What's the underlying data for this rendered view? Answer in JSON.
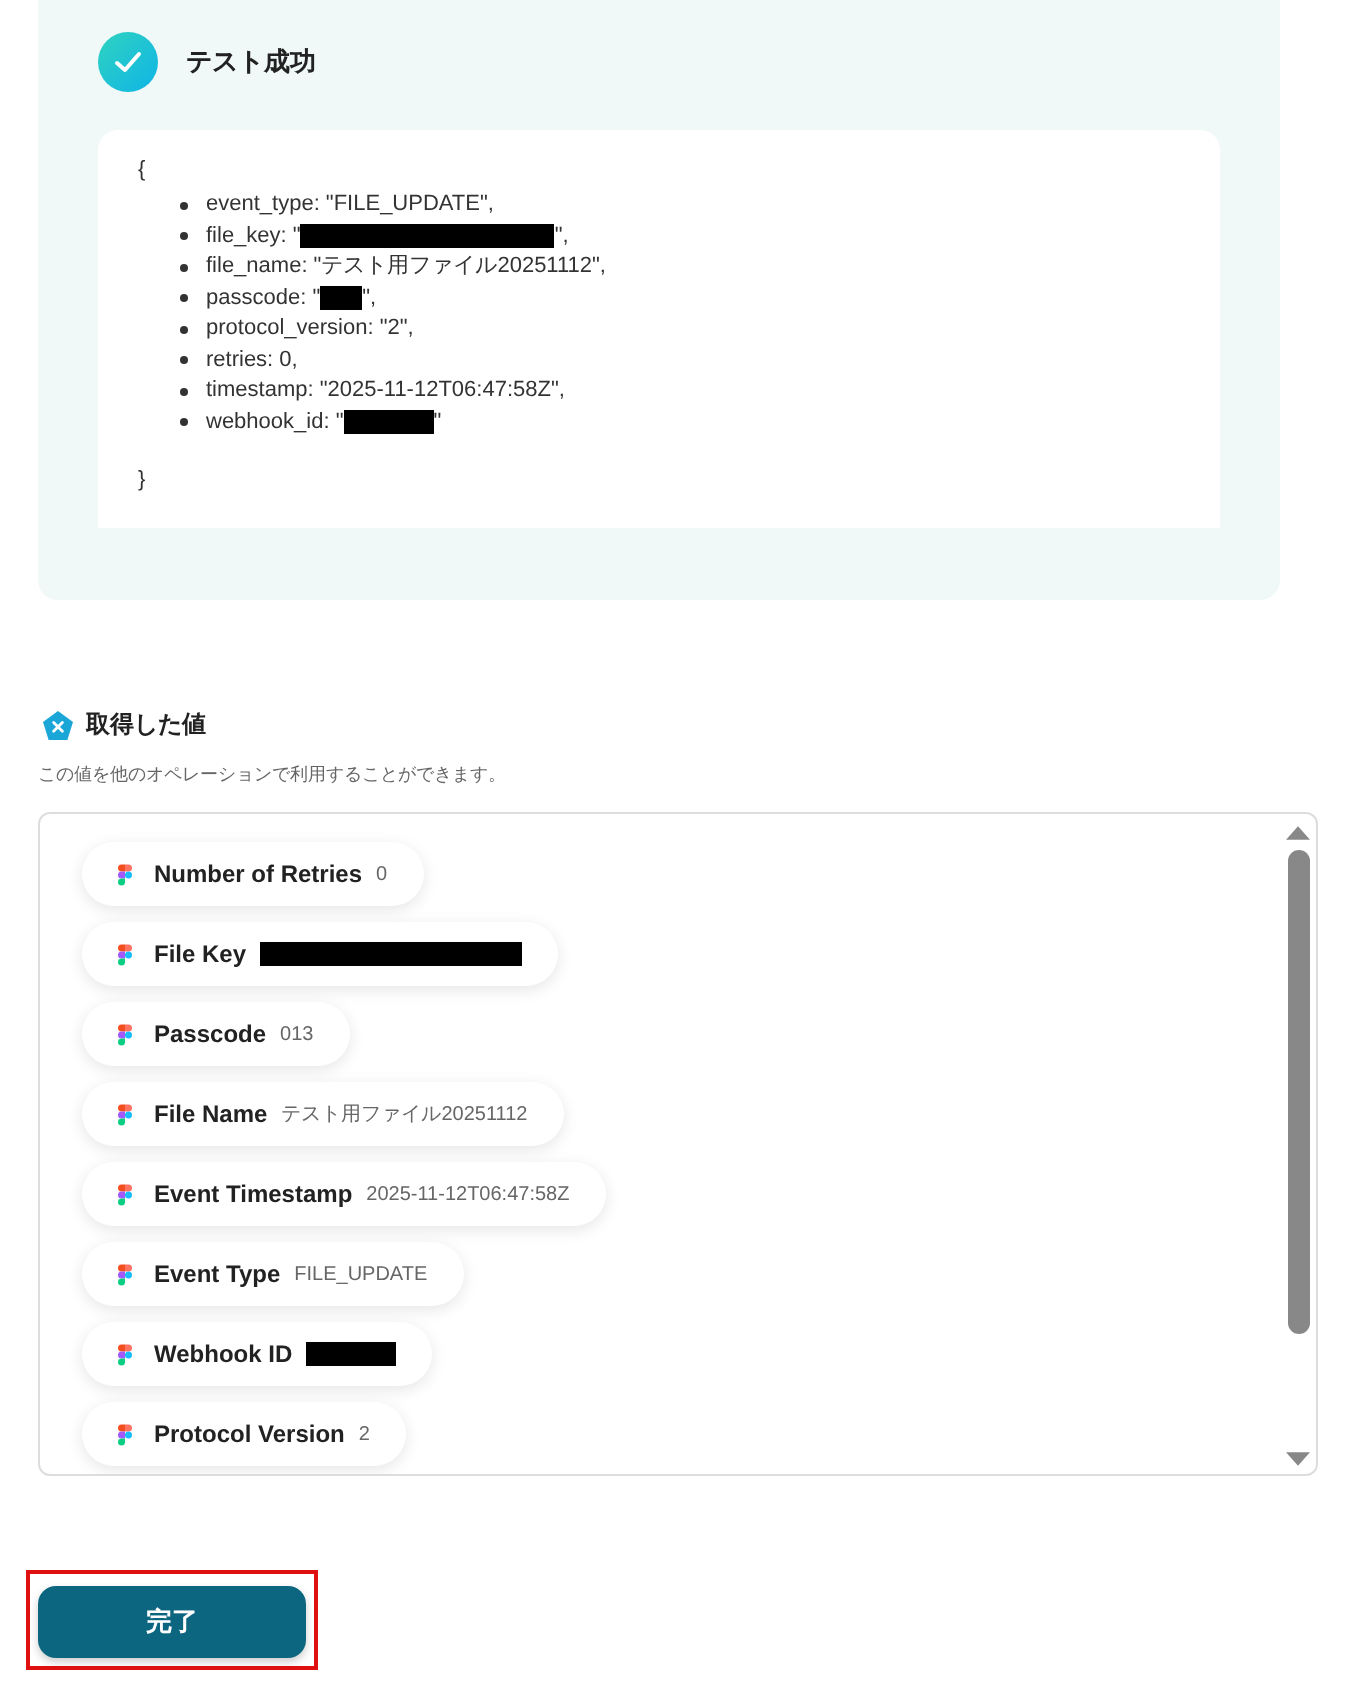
{
  "test_result": {
    "title": "テスト成功",
    "open_brace": "{",
    "close_brace": "}",
    "lines": [
      {
        "prefix": "event_type: \"FILE_UPDATE\","
      },
      {
        "prefix": "file_key: \"",
        "redacted": true,
        "suffix": "\","
      },
      {
        "prefix": "file_name: \"テスト用ファイル20251112\","
      },
      {
        "prefix": "passcode: \"",
        "redacted": true,
        "suffix": "\","
      },
      {
        "prefix": "protocol_version: \"2\","
      },
      {
        "prefix": "retries: 0,"
      },
      {
        "prefix": "timestamp: \"2025-11-12T06:47:58Z\","
      },
      {
        "prefix": "webhook_id: \"",
        "redacted": true,
        "suffix": "\""
      }
    ]
  },
  "values_section": {
    "title": "取得した値",
    "description": "この値を他のオペレーションで利用することができます。",
    "items": [
      {
        "label": "Number of Retries",
        "value": "0"
      },
      {
        "label": "File Key",
        "redacted": true
      },
      {
        "label": "Passcode",
        "value": "013"
      },
      {
        "label": "File Name",
        "value": "テスト用ファイル20251112"
      },
      {
        "label": "Event Timestamp",
        "value": "2025-11-12T06:47:58Z"
      },
      {
        "label": "Event Type",
        "value": "FILE_UPDATE"
      },
      {
        "label": "Webhook ID",
        "redacted": true
      },
      {
        "label": "Protocol Version",
        "value": "2"
      }
    ]
  },
  "done_button": {
    "label": "完了",
    "highlighted": true
  }
}
